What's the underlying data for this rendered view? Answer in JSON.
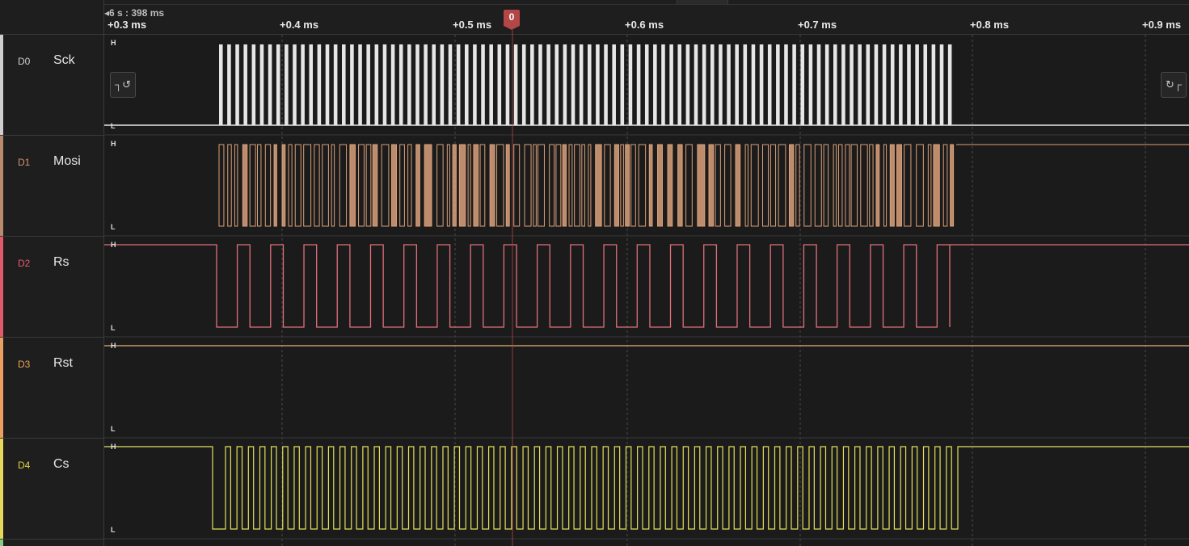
{
  "ruler": {
    "offset_label": "6 s : 398 ms",
    "ticks": [
      "+0.3 ms",
      "+0.4 ms",
      "+0.5 ms",
      "+0.6 ms",
      "+0.7 ms",
      "+0.8 ms",
      "+0.9 ms"
    ],
    "marker_label": "0"
  },
  "channels": [
    {
      "id": "D0",
      "name": "Sck",
      "color": "#e6e6e6",
      "strip": "#cfcfcf",
      "id_color": "#cfcfcf"
    },
    {
      "id": "D1",
      "name": "Mosi",
      "color": "#d8a07a",
      "strip": "#b98a6c",
      "id_color": "#d4956a"
    },
    {
      "id": "D2",
      "name": "Rs",
      "color": "#e0707a",
      "strip": "#e25b68",
      "id_color": "#e85c6c"
    },
    {
      "id": "D3",
      "name": "Rst",
      "color": "#e8b070",
      "strip": "#eaa060",
      "id_color": "#e8a258"
    },
    {
      "id": "D4",
      "name": "Cs",
      "color": "#e6e05a",
      "strip": "#e6d85a",
      "id_color": "#e3d244"
    }
  ],
  "levels": {
    "high": "H",
    "low": "L"
  },
  "nav": {
    "left_icon": "jump-to-previous-edge-icon",
    "right_icon": "jump-to-next-edge-icon",
    "left_glyph": "┐↺",
    "right_glyph": "↻┌"
  },
  "colors": {
    "marker": "#b34646",
    "grid": "#4a4a4a",
    "background": "#1b1b1b"
  }
}
